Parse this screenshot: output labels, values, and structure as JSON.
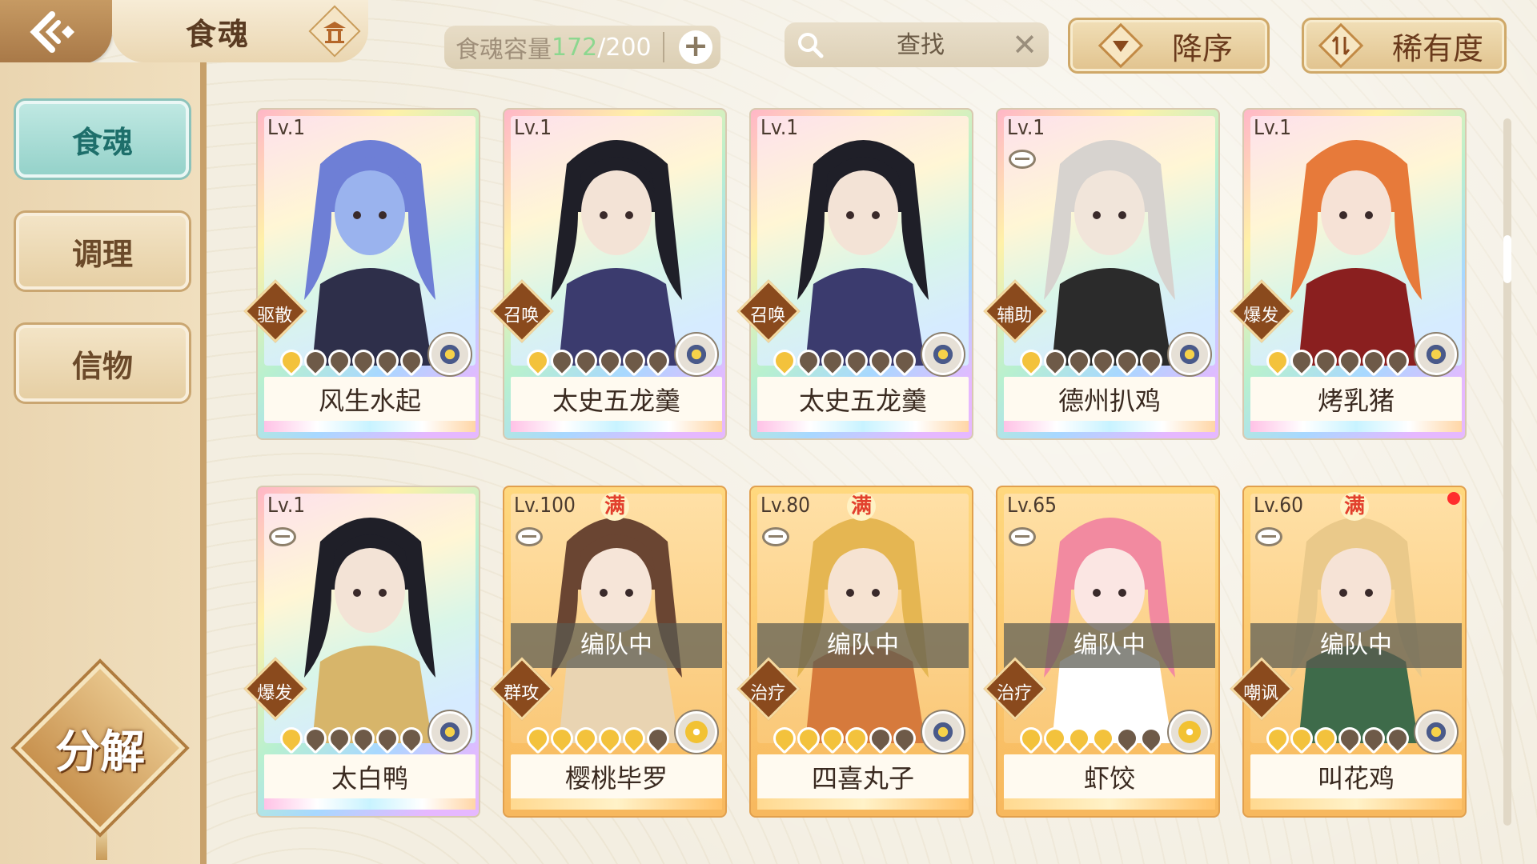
{
  "header": {
    "title": "食魂",
    "capacity_label": "食魂容量",
    "capacity_current": "172",
    "capacity_max": "/200",
    "search_placeholder": "查找",
    "sort_order_label": "降序",
    "sort_field_label": "稀有度"
  },
  "sidebar": {
    "items": [
      {
        "label": "食魂",
        "active": true
      },
      {
        "label": "调理",
        "active": false
      },
      {
        "label": "信物",
        "active": false
      }
    ],
    "decompose_label": "分解"
  },
  "cards": [
    {
      "level": "Lv.1",
      "name": "风生水起",
      "role": "驱散",
      "stars": 1,
      "frame": "rainbow",
      "skin": "#9ab3ee",
      "hair": "#6e7fd6",
      "outfit": "#2e2f4a"
    },
    {
      "level": "Lv.1",
      "name": "太史五龙羹",
      "role": "召唤",
      "stars": 1,
      "frame": "rainbow",
      "skin": "#f3e3d6",
      "hair": "#1f1f28",
      "outfit": "#3b3b6e"
    },
    {
      "level": "Lv.1",
      "name": "太史五龙羹",
      "role": "召唤",
      "stars": 1,
      "frame": "rainbow",
      "skin": "#f3e3d6",
      "hair": "#1f1f28",
      "outfit": "#3b3b6e"
    },
    {
      "level": "Lv.1",
      "name": "德州扒鸡",
      "role": "辅助",
      "stars": 1,
      "frame": "rainbow",
      "locked": true,
      "skin": "#f1e5da",
      "hair": "#d7d3cf",
      "outfit": "#2b2b2b"
    },
    {
      "level": "Lv.1",
      "name": "烤乳猪",
      "role": "爆发",
      "stars": 1,
      "frame": "rainbow",
      "skin": "#f6e2d6",
      "hair": "#e77a3a",
      "outfit": "#8a1f1f"
    },
    {
      "level": "Lv.1",
      "name": "太白鸭",
      "role": "爆发",
      "stars": 1,
      "frame": "rainbow",
      "locked": true,
      "skin": "#f3e3d6",
      "hair": "#1f1f28",
      "outfit": "#d7b56a"
    },
    {
      "level": "Lv.100",
      "name": "樱桃毕罗",
      "role": "群攻",
      "stars": 5,
      "frame": "gold",
      "maxed": "满",
      "locked": true,
      "busy": "编队中",
      "medal": "gold",
      "skin": "#f6e5d8",
      "hair": "#6a4532",
      "outfit": "#e9d4b2"
    },
    {
      "level": "Lv.80",
      "name": "四喜丸子",
      "role": "治疗",
      "stars": 4,
      "frame": "gold",
      "maxed": "满",
      "locked": true,
      "busy": "编队中",
      "skin": "#f6e3d2",
      "hair": "#e5b652",
      "outfit": "#d67a3c"
    },
    {
      "level": "Lv.65",
      "name": "虾饺",
      "role": "治疗",
      "stars": 4,
      "frame": "gold",
      "locked": true,
      "busy": "编队中",
      "medal": "gold",
      "skin": "#fbe6e3",
      "hair": "#f28aa0",
      "outfit": "#ffffff"
    },
    {
      "level": "Lv.60",
      "name": "叫花鸡",
      "role": "嘲讽",
      "stars": 3,
      "frame": "gold",
      "maxed": "满",
      "locked": true,
      "busy": "编队中",
      "dot": true,
      "skin": "#f6e3d6",
      "hair": "#eac98a",
      "outfit": "#3e6b4a"
    }
  ]
}
